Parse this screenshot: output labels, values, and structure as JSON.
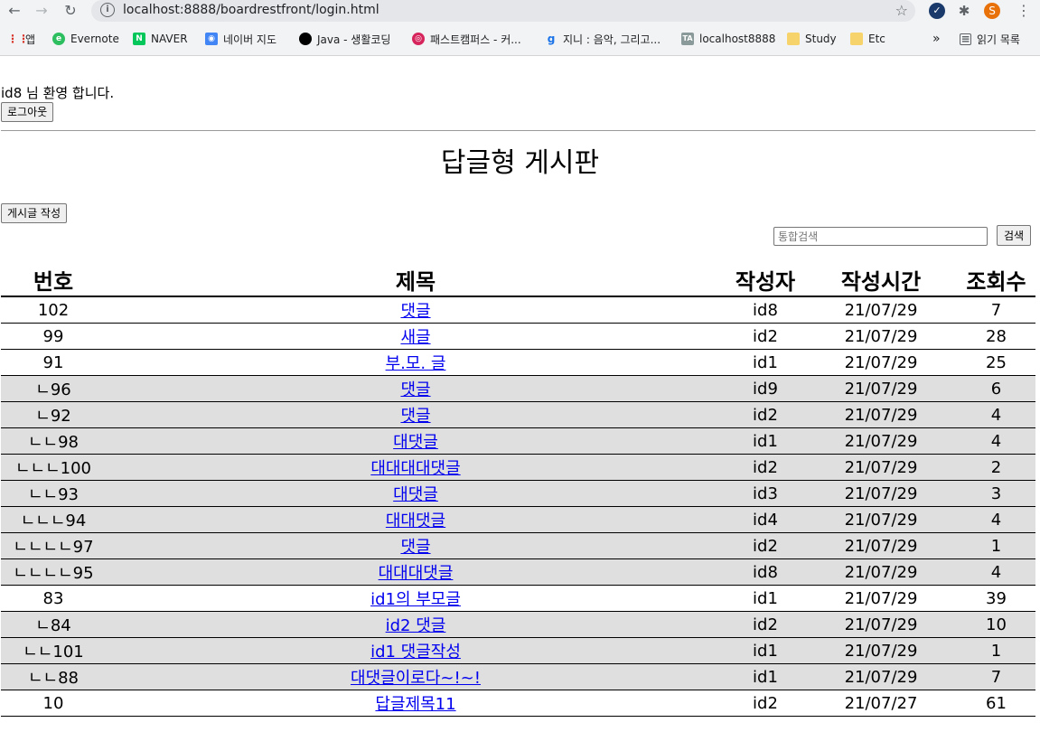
{
  "browser": {
    "url": "localhost:8888/boardrestfront/login.html",
    "profile_initial": "S",
    "bookmarks": [
      {
        "label": "앱",
        "icon": "apps-grid-icon"
      },
      {
        "label": "Evernote",
        "icon": "evernote-icon"
      },
      {
        "label": "NAVER",
        "icon": "naver-icon"
      },
      {
        "label": "네이버 지도",
        "icon": "naver-map-icon"
      },
      {
        "label": "Java - 생활코딩",
        "icon": "opentutorials-icon"
      },
      {
        "label": "패스트캠퍼스 - 커...",
        "icon": "fastcampus-icon"
      },
      {
        "label": "지니 : 음악, 그리고...",
        "icon": "genie-icon"
      },
      {
        "label": "localhost8888",
        "icon": "ta-icon"
      },
      {
        "label": "Study",
        "icon": "folder-icon"
      },
      {
        "label": "Etc",
        "icon": "folder-icon"
      }
    ],
    "more_bookmarks": "»",
    "reading_list": "읽기 목록"
  },
  "page": {
    "welcome": "id8 님 환영 합니다.",
    "logout_label": "로그아웃",
    "title": "답글형 게시판",
    "write_label": "게시글 작성",
    "search_placeholder": "통합검색",
    "search_label": "검색"
  },
  "table": {
    "headers": [
      "번호",
      "제목",
      "작성자",
      "작성시간",
      "조회수"
    ],
    "rows": [
      {
        "no": "102",
        "title": "댓글",
        "writer": "id8",
        "date": "21/07/29",
        "views": "7",
        "reply": false
      },
      {
        "no": "99",
        "title": "새글",
        "writer": "id2",
        "date": "21/07/29",
        "views": "28",
        "reply": false
      },
      {
        "no": "91",
        "title": "부.모. 글",
        "writer": "id1",
        "date": "21/07/29",
        "views": "25",
        "reply": false
      },
      {
        "no": "ㄴ96",
        "title": "댓글",
        "writer": "id9",
        "date": "21/07/29",
        "views": "6",
        "reply": true
      },
      {
        "no": "ㄴ92",
        "title": "댓글",
        "writer": "id2",
        "date": "21/07/29",
        "views": "4",
        "reply": true
      },
      {
        "no": "ㄴㄴ98",
        "title": "대댓글",
        "writer": "id1",
        "date": "21/07/29",
        "views": "4",
        "reply": true
      },
      {
        "no": "ㄴㄴㄴ100",
        "title": "대대대대댓글",
        "writer": "id2",
        "date": "21/07/29",
        "views": "2",
        "reply": true
      },
      {
        "no": "ㄴㄴ93",
        "title": "대댓글",
        "writer": "id3",
        "date": "21/07/29",
        "views": "3",
        "reply": true
      },
      {
        "no": "ㄴㄴㄴ94",
        "title": "대대댓글",
        "writer": "id4",
        "date": "21/07/29",
        "views": "4",
        "reply": true
      },
      {
        "no": "ㄴㄴㄴㄴ97",
        "title": "댓글",
        "writer": "id2",
        "date": "21/07/29",
        "views": "1",
        "reply": true
      },
      {
        "no": "ㄴㄴㄴㄴ95",
        "title": "대대대댓글",
        "writer": "id8",
        "date": "21/07/29",
        "views": "4",
        "reply": true
      },
      {
        "no": "83",
        "title": "id1의 부모글",
        "writer": "id1",
        "date": "21/07/29",
        "views": "39",
        "reply": false
      },
      {
        "no": "ㄴ84",
        "title": "id2 댓글",
        "writer": "id2",
        "date": "21/07/29",
        "views": "10",
        "reply": true
      },
      {
        "no": "ㄴㄴ101",
        "title": "id1 댓글작성",
        "writer": "id1",
        "date": "21/07/29",
        "views": "1",
        "reply": true
      },
      {
        "no": "ㄴㄴ88",
        "title": "대댓글이로다~!~!",
        "writer": "id1",
        "date": "21/07/29",
        "views": "7",
        "reply": true
      },
      {
        "no": "10",
        "title": "답글제목11",
        "writer": "id2",
        "date": "21/07/27",
        "views": "61",
        "reply": false
      }
    ]
  }
}
